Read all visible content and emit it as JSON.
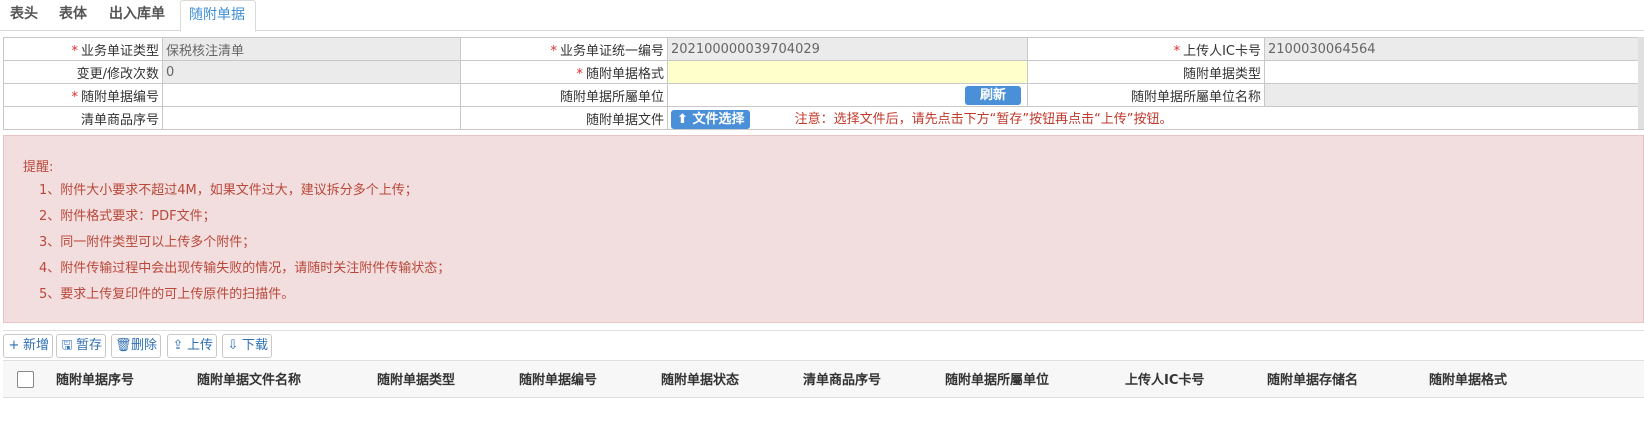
{
  "tabs": [
    "表头",
    "表体",
    "出入库单",
    "随附单据"
  ],
  "form": {
    "row1": {
      "l1": "业务单证类型",
      "v1": "保税核注清单",
      "l2": "业务单证统一编号",
      "v2": "202100000039704029",
      "l3": "上传人IC卡号",
      "v3": "2100030064564"
    },
    "row2": {
      "l1": "变更/修改次数",
      "v1": "0",
      "l2": "随附单据格式",
      "v2": "",
      "l3": "随附单据类型",
      "v3": ""
    },
    "row3": {
      "l1": "随附单据编号",
      "v1": "",
      "l2": "随附单据所屬单位",
      "refresh": "刷新",
      "l3": "随附单据所屬单位名称",
      "v3": ""
    },
    "row4": {
      "l1": "清单商品序号",
      "v1": "",
      "l2": "随附单据文件",
      "file_btn": "文件选择",
      "notice": "注意：选择文件后，请先点击下方“暂存”按钮再点击“上传”按钮。"
    }
  },
  "reminder": {
    "title": "提醒:",
    "items": [
      "1、附件大小要求不超过4M，如果文件过大，建议拆分多个上传；",
      "2、附件格式要求：PDF文件；",
      "3、同一附件类型可以上传多个附件；",
      "4、附件传输过程中会出现传输失败的情况，请随时关注附件传输状态；",
      "5、要求上传复印件的可上传原件的扫描件。"
    ]
  },
  "toolbar": {
    "add": "新增",
    "save": "暂存",
    "delete": "删除",
    "upload": "上传",
    "download": "下载"
  },
  "grid_columns": [
    "随附单据序号",
    "随附单据文件名称",
    "随附单据类型",
    "随附单据编号",
    "随附单据状态",
    "清单商品序号",
    "随附单据所屬单位",
    "上传人IC卡号",
    "随附单据存储名",
    "随附单据格式"
  ],
  "colors": {
    "accent": "#4a90d9",
    "required": "#e0282e",
    "reminder_bg": "#f2dede",
    "reminder_text": "#b9483a",
    "field_yellow": "#ffffcc"
  }
}
